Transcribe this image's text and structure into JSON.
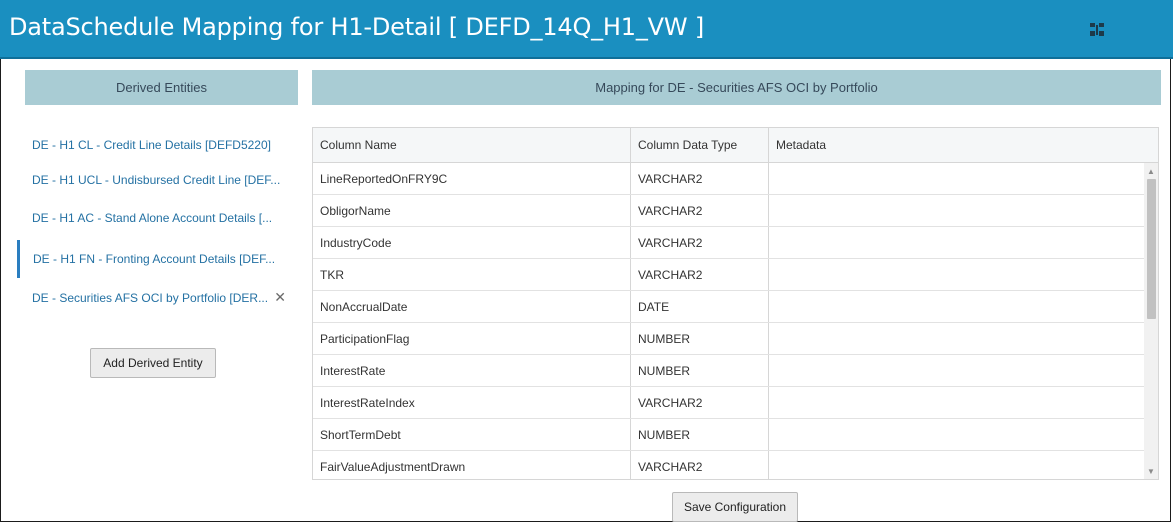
{
  "window": {
    "title": "DataSchedule Mapping for H1-Detail [ DEFD_14Q_H1_VW ]",
    "icon": "collapse-expand-icon"
  },
  "left_panel": {
    "header": "Derived Entities",
    "items": [
      {
        "label": "DE - H1 CL - Credit Line Details [DEFD5220]"
      },
      {
        "label": "DE - H1 UCL - Undisbursed Credit Line [DEF..."
      },
      {
        "label": "DE - H1 AC - Stand Alone Account Details [..."
      },
      {
        "label": "DE - H1 FN - Fronting Account Details [DEF..."
      },
      {
        "label": "DE - Securities AFS OCI by Portfolio [DER...",
        "close": "✕"
      }
    ],
    "add_button": "Add Derived Entity"
  },
  "right_panel": {
    "header": "Mapping for DE - Securities AFS OCI by Portfolio",
    "columns": [
      "Column Name",
      "Column Data Type",
      "Metadata"
    ],
    "rows": [
      {
        "name": "LineReportedOnFRY9C",
        "type": "VARCHAR2",
        "metadata": ""
      },
      {
        "name": "ObligorName",
        "type": "VARCHAR2",
        "metadata": ""
      },
      {
        "name": "IndustryCode",
        "type": "VARCHAR2",
        "metadata": ""
      },
      {
        "name": "TKR",
        "type": "VARCHAR2",
        "metadata": ""
      },
      {
        "name": "NonAccrualDate",
        "type": "DATE",
        "metadata": ""
      },
      {
        "name": "ParticipationFlag",
        "type": "NUMBER",
        "metadata": ""
      },
      {
        "name": "InterestRate",
        "type": "NUMBER",
        "metadata": ""
      },
      {
        "name": "InterestRateIndex",
        "type": "VARCHAR2",
        "metadata": ""
      },
      {
        "name": "ShortTermDebt",
        "type": "NUMBER",
        "metadata": ""
      },
      {
        "name": "FairValueAdjustmentDrawn",
        "type": "VARCHAR2",
        "metadata": ""
      }
    ],
    "save_button": "Save Configuration"
  },
  "colors": {
    "title_bar": "#1a8fc0",
    "panel_header": "#a9ccd4",
    "link": "#2471a3"
  }
}
